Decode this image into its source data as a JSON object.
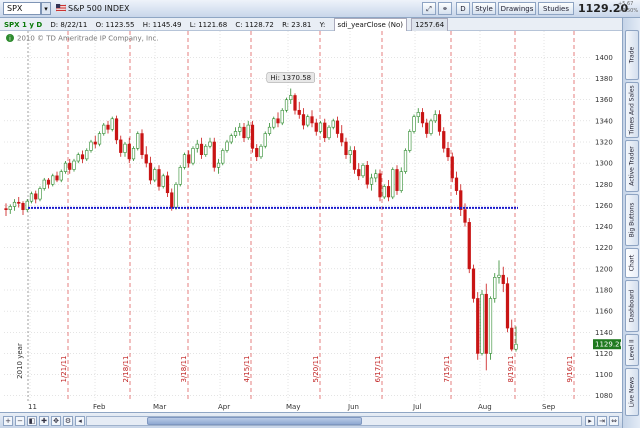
{
  "toolbar": {
    "symbol": "SPX",
    "company": "S&P 500 INDEX",
    "buttons": {
      "d": "D",
      "style": "Style",
      "drawings": "Drawings",
      "studies": "Studies"
    },
    "last_price": "1129.20",
    "change": "+5.67",
    "change_pct": "+0.50%"
  },
  "infobar": {
    "symbol_period": "SPX 1 y D",
    "date": "D: 8/22/11",
    "open": "O: 1123.55",
    "high": "H: 1145.49",
    "low": "L: 1121.68",
    "close": "C: 1128.72",
    "range": "R: 23.81",
    "y_label": "Y:",
    "study_name": "sdi_yearClose (No)",
    "study_value": "1257.64"
  },
  "chart": {
    "copyright": "2010 © TD Ameritrade IP Company, Inc.",
    "high_label": "Hi: 1370.58",
    "year_label": "2010 year",
    "current_price_label": "1129.20",
    "colors": {
      "up": "#2e8b2e",
      "down": "#c81414",
      "reference_line": "#1a1acc",
      "vline": "#e06060",
      "price_badge": "#1f7a1f"
    }
  },
  "chart_data": {
    "type": "candlestick",
    "ylim": [
      1075,
      1425
    ],
    "y_ticks": [
      1080,
      1100,
      1120,
      1140,
      1160,
      1180,
      1200,
      1220,
      1240,
      1260,
      1280,
      1300,
      1320,
      1340,
      1360,
      1380,
      1400
    ],
    "x_ticks": [
      "11",
      "Feb",
      "Mar",
      "Apr",
      "May",
      "Jun",
      "Jul",
      "Aug",
      "Sep"
    ],
    "event_dates": [
      "1/21/11",
      "2/18/11",
      "3/18/11",
      "4/15/11",
      "5/20/11",
      "6/17/11",
      "7/15/11",
      "8/19/11",
      "9/16/11"
    ],
    "reference_line": {
      "name": "sdi_yearClose",
      "value": 1257.64
    },
    "annotations": [
      {
        "text": "Hi: 1370.58",
        "value": 1370.58
      }
    ],
    "ohlc": [
      [
        1257,
        1262,
        1250,
        1256
      ],
      [
        1256,
        1261,
        1252,
        1259
      ],
      [
        1259,
        1266,
        1255,
        1263
      ],
      [
        1263,
        1268,
        1258,
        1262
      ],
      [
        1262,
        1264,
        1251,
        1256
      ],
      [
        1256,
        1266,
        1254,
        1264
      ],
      [
        1264,
        1273,
        1262,
        1271
      ],
      [
        1271,
        1274,
        1262,
        1266
      ],
      [
        1266,
        1278,
        1264,
        1276
      ],
      [
        1276,
        1286,
        1274,
        1284
      ],
      [
        1284,
        1286,
        1276,
        1280
      ],
      [
        1280,
        1290,
        1278,
        1288
      ],
      [
        1288,
        1292,
        1282,
        1284
      ],
      [
        1284,
        1294,
        1282,
        1292
      ],
      [
        1292,
        1302,
        1290,
        1300
      ],
      [
        1300,
        1304,
        1290,
        1294
      ],
      [
        1294,
        1304,
        1292,
        1302
      ],
      [
        1302,
        1310,
        1300,
        1308
      ],
      [
        1308,
        1312,
        1300,
        1304
      ],
      [
        1304,
        1314,
        1302,
        1312
      ],
      [
        1312,
        1322,
        1310,
        1320
      ],
      [
        1320,
        1326,
        1314,
        1318
      ],
      [
        1318,
        1330,
        1316,
        1328
      ],
      [
        1328,
        1338,
        1326,
        1336
      ],
      [
        1336,
        1340,
        1328,
        1332
      ],
      [
        1332,
        1344,
        1330,
        1342
      ],
      [
        1342,
        1345,
        1318,
        1322
      ],
      [
        1322,
        1326,
        1306,
        1310
      ],
      [
        1310,
        1320,
        1306,
        1318
      ],
      [
        1318,
        1324,
        1300,
        1304
      ],
      [
        1304,
        1316,
        1302,
        1314
      ],
      [
        1314,
        1330,
        1312,
        1328
      ],
      [
        1328,
        1332,
        1304,
        1308
      ],
      [
        1308,
        1316,
        1296,
        1300
      ],
      [
        1300,
        1306,
        1280,
        1284
      ],
      [
        1284,
        1296,
        1282,
        1294
      ],
      [
        1294,
        1298,
        1274,
        1278
      ],
      [
        1278,
        1290,
        1276,
        1288
      ],
      [
        1288,
        1292,
        1268,
        1272
      ],
      [
        1272,
        1276,
        1255,
        1258
      ],
      [
        1258,
        1282,
        1256,
        1280
      ],
      [
        1280,
        1298,
        1278,
        1296
      ],
      [
        1296,
        1310,
        1294,
        1308
      ],
      [
        1308,
        1312,
        1296,
        1300
      ],
      [
        1300,
        1316,
        1298,
        1314
      ],
      [
        1314,
        1322,
        1310,
        1318
      ],
      [
        1318,
        1324,
        1304,
        1308
      ],
      [
        1308,
        1318,
        1306,
        1316
      ],
      [
        1316,
        1324,
        1314,
        1320
      ],
      [
        1320,
        1324,
        1292,
        1296
      ],
      [
        1296,
        1304,
        1290,
        1300
      ],
      [
        1300,
        1314,
        1298,
        1312
      ],
      [
        1312,
        1322,
        1310,
        1320
      ],
      [
        1320,
        1328,
        1318,
        1326
      ],
      [
        1326,
        1334,
        1324,
        1330
      ],
      [
        1330,
        1338,
        1326,
        1334
      ],
      [
        1334,
        1338,
        1320,
        1324
      ],
      [
        1324,
        1340,
        1322,
        1336
      ],
      [
        1336,
        1340,
        1310,
        1314
      ],
      [
        1314,
        1318,
        1302,
        1306
      ],
      [
        1306,
        1318,
        1304,
        1316
      ],
      [
        1316,
        1330,
        1314,
        1328
      ],
      [
        1328,
        1338,
        1326,
        1334
      ],
      [
        1334,
        1344,
        1332,
        1342
      ],
      [
        1342,
        1348,
        1334,
        1338
      ],
      [
        1338,
        1352,
        1336,
        1350
      ],
      [
        1350,
        1362,
        1348,
        1360
      ],
      [
        1360,
        1370.58,
        1356,
        1364
      ],
      [
        1364,
        1366,
        1346,
        1350
      ],
      [
        1350,
        1358,
        1342,
        1346
      ],
      [
        1346,
        1352,
        1332,
        1336
      ],
      [
        1336,
        1346,
        1334,
        1344
      ],
      [
        1344,
        1350,
        1334,
        1338
      ],
      [
        1338,
        1342,
        1326,
        1330
      ],
      [
        1330,
        1340,
        1328,
        1338
      ],
      [
        1338,
        1342,
        1320,
        1324
      ],
      [
        1324,
        1336,
        1322,
        1334
      ],
      [
        1334,
        1342,
        1332,
        1340
      ],
      [
        1340,
        1344,
        1324,
        1328
      ],
      [
        1328,
        1336,
        1316,
        1320
      ],
      [
        1320,
        1324,
        1304,
        1308
      ],
      [
        1308,
        1316,
        1300,
        1312
      ],
      [
        1312,
        1316,
        1290,
        1294
      ],
      [
        1294,
        1300,
        1284,
        1288
      ],
      [
        1288,
        1300,
        1286,
        1298
      ],
      [
        1298,
        1302,
        1276,
        1280
      ],
      [
        1280,
        1290,
        1274,
        1286
      ],
      [
        1286,
        1294,
        1282,
        1290
      ],
      [
        1290,
        1294,
        1264,
        1268
      ],
      [
        1268,
        1280,
        1266,
        1278
      ],
      [
        1278,
        1284,
        1264,
        1268
      ],
      [
        1268,
        1296,
        1266,
        1294
      ],
      [
        1294,
        1298,
        1270,
        1274
      ],
      [
        1274,
        1296,
        1272,
        1292
      ],
      [
        1292,
        1314,
        1290,
        1312
      ],
      [
        1312,
        1332,
        1310,
        1330
      ],
      [
        1330,
        1346,
        1328,
        1344
      ],
      [
        1344,
        1352,
        1338,
        1348
      ],
      [
        1348,
        1352,
        1334,
        1338
      ],
      [
        1338,
        1342,
        1324,
        1328
      ],
      [
        1328,
        1342,
        1326,
        1340
      ],
      [
        1340,
        1350,
        1338,
        1346
      ],
      [
        1346,
        1350,
        1326,
        1330
      ],
      [
        1330,
        1334,
        1310,
        1314
      ],
      [
        1314,
        1320,
        1302,
        1306
      ],
      [
        1306,
        1310,
        1282,
        1286
      ],
      [
        1286,
        1292,
        1270,
        1274
      ],
      [
        1274,
        1280,
        1250,
        1256
      ],
      [
        1256,
        1262,
        1240,
        1244
      ],
      [
        1244,
        1248,
        1196,
        1200
      ],
      [
        1200,
        1204,
        1168,
        1172
      ],
      [
        1172,
        1178,
        1114,
        1120
      ],
      [
        1120,
        1180,
        1118,
        1176
      ],
      [
        1176,
        1186,
        1104,
        1120
      ],
      [
        1120,
        1174,
        1114,
        1172
      ],
      [
        1172,
        1196,
        1168,
        1192
      ],
      [
        1192,
        1208,
        1186,
        1194
      ],
      [
        1194,
        1202,
        1178,
        1186
      ],
      [
        1186,
        1192,
        1140,
        1144
      ],
      [
        1144,
        1152,
        1122,
        1124
      ],
      [
        1124,
        1145.49,
        1121.68,
        1128.72
      ]
    ]
  }
}
